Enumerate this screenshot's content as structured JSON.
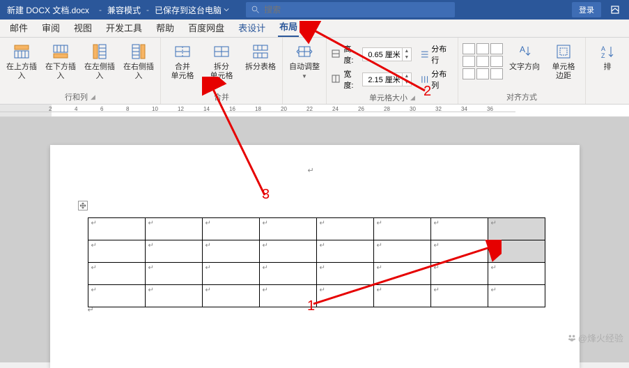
{
  "titlebar": {
    "doc_name": "新建 DOCX 文档.docx",
    "compat": "兼容模式",
    "saved": "已保存到这台电脑",
    "login": "登录"
  },
  "search": {
    "placeholder": "搜索"
  },
  "tabs": {
    "mail": "邮件",
    "review": "审阅",
    "view": "视图",
    "dev": "开发工具",
    "help": "帮助",
    "baidu": "百度网盘",
    "table_design": "表设计",
    "layout": "布局"
  },
  "ribbon": {
    "rows_cols": {
      "insert_above": "在上方插入",
      "insert_below": "在下方插入",
      "insert_left": "在左侧插入",
      "insert_right": "在右侧插入",
      "group": "行和列"
    },
    "merge": {
      "merge_cells": "合并\n单元格",
      "split_cells": "拆分\n单元格",
      "split_table": "拆分表格",
      "group": "合并"
    },
    "autofit": {
      "label": "自动调整"
    },
    "cellsize": {
      "height_label": "高度:",
      "height_val": "0.65 厘米",
      "width_label": "宽度:",
      "width_val": "2.15 厘米",
      "dist_rows": "分布行",
      "dist_cols": "分布列",
      "group": "单元格大小"
    },
    "align": {
      "text_dir": "文字方向",
      "cell_margin": "单元格\n边距",
      "group": "对齐方式"
    },
    "sort": {
      "label": "排"
    }
  },
  "ruler": {
    "marks": [
      "2",
      "",
      "2",
      "4",
      "6",
      "8",
      "10",
      "12",
      "14",
      "16",
      "18",
      "20",
      "22",
      "24",
      "26",
      "28",
      "30",
      "32",
      "34",
      "36"
    ]
  },
  "annotations": {
    "n1": "1",
    "n2": "2",
    "n3": "3"
  },
  "watermark": "@烽火经验",
  "chart_data": {
    "type": "table",
    "rows": 4,
    "cols": 8,
    "selected_cells": [
      [
        0,
        7
      ],
      [
        1,
        7
      ]
    ],
    "cell_content": "↵"
  }
}
